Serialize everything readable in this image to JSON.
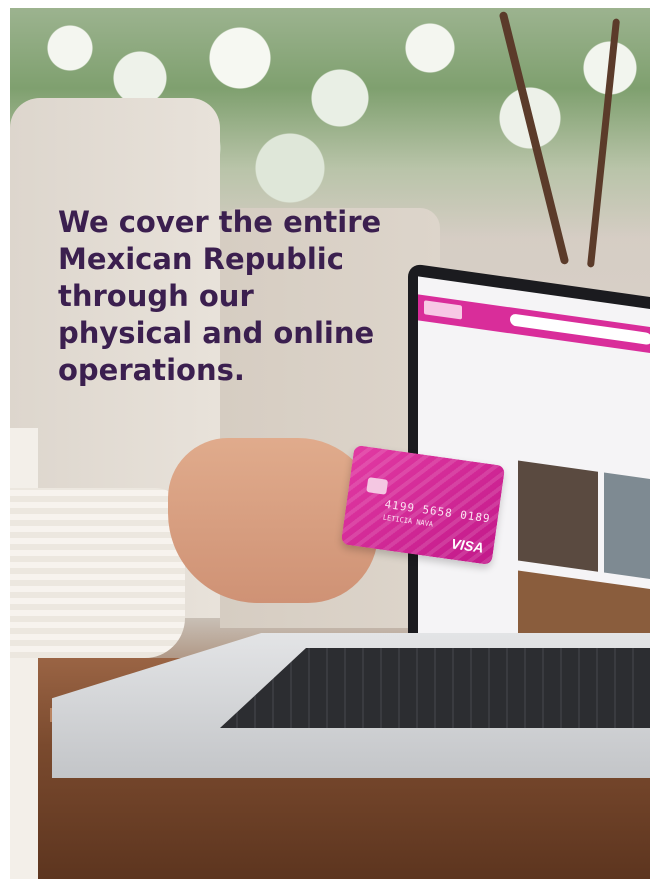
{
  "headline": {
    "lines": [
      "We cover the entire",
      "Mexican Republic",
      "through our",
      "physical and online",
      "operations."
    ]
  },
  "card": {
    "number": "4199 5658 0189",
    "name": "LETICIA NAVA",
    "brand": "VISA"
  },
  "colors": {
    "headline": "#3b1f4f",
    "card": "#d62c9b",
    "screen_header": "#d92d9a"
  }
}
